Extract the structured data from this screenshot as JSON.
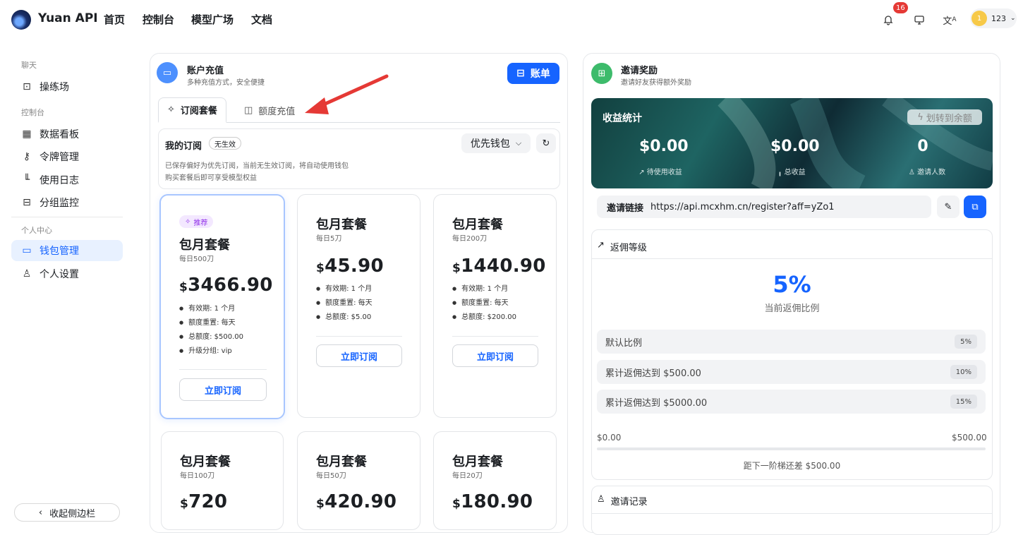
{
  "header": {
    "brand": "Yuan API",
    "nav": [
      "首页",
      "控制台",
      "模型广场",
      "文档"
    ],
    "notification_count": "16",
    "user_avatar": "1",
    "user_name": "123"
  },
  "sidebar": {
    "sections": [
      "聊天",
      "控制台",
      "个人中心"
    ],
    "items": [
      {
        "label": "操练场",
        "icon": "playground-icon"
      },
      {
        "label": "数据看板",
        "icon": "dashboard-icon"
      },
      {
        "label": "令牌管理",
        "icon": "key-icon"
      },
      {
        "label": "使用日志",
        "icon": "chart-icon"
      },
      {
        "label": "分组监控",
        "icon": "monitor-icon"
      },
      {
        "label": "钱包管理",
        "icon": "wallet-icon",
        "active": true
      },
      {
        "label": "个人设置",
        "icon": "user-icon"
      }
    ],
    "collapse_label": "收起侧边栏"
  },
  "recharge": {
    "title": "账户充值",
    "subtitle": "多种充值方式，安全便捷",
    "bill_button": "账单",
    "tabs": [
      "订阅套餐",
      "额度充值"
    ],
    "my_sub_title": "我的订阅",
    "my_sub_status": "无生效",
    "wallet_pref": "优先钱包",
    "note1": "已保存偏好为优先订阅，当前无生效订阅，将自动使用钱包",
    "note2": "购买套餐后即可享受模型权益",
    "recommend": "推荐",
    "subscribe": "立即订阅",
    "plans": [
      {
        "name": "包月套餐",
        "desc": "每日500刀",
        "price": "3466.90",
        "features": [
          "有效期: 1 个月",
          "额度重置: 每天",
          "总额度: $500.00",
          "升级分组: vip"
        ]
      },
      {
        "name": "包月套餐",
        "desc": "每日5刀",
        "price": "45.90",
        "features": [
          "有效期: 1 个月",
          "额度重置: 每天",
          "总额度: $5.00"
        ]
      },
      {
        "name": "包月套餐",
        "desc": "每日200刀",
        "price": "1440.90",
        "features": [
          "有效期: 1 个月",
          "额度重置: 每天",
          "总额度: $200.00"
        ]
      },
      {
        "name": "包月套餐",
        "desc": "每日100刀",
        "price": "720"
      },
      {
        "name": "包月套餐",
        "desc": "每日50刀",
        "price": "420.90"
      },
      {
        "name": "包月套餐",
        "desc": "每日20刀",
        "price": "180.90"
      }
    ],
    "currency": "$"
  },
  "invite": {
    "title": "邀请奖励",
    "subtitle": "邀请好友获得额外奖励",
    "stats_title": "收益统计",
    "transfer_button": "划转到余额",
    "stats": [
      {
        "value": "$0.00",
        "label": "待使用收益"
      },
      {
        "value": "$0.00",
        "label": "总收益"
      },
      {
        "value": "0",
        "label": "邀请人数"
      }
    ],
    "link_label": "邀请链接",
    "link": "https://api.mcxhm.cn/register?aff=yZo1",
    "level_title": "返佣等级",
    "rate": "5%",
    "rate_label": "当前返佣比例",
    "levels": [
      {
        "label": "默认比例",
        "tag": "5%"
      },
      {
        "label": "累计返佣达到 $500.00",
        "tag": "10%"
      },
      {
        "label": "累计返佣达到 $5000.00",
        "tag": "15%"
      }
    ],
    "progress_start": "$0.00",
    "progress_end": "$500.00",
    "progress_fraction": 0,
    "progress_text": "距下一阶梯还差 $500.00",
    "records_title": "邀请记录"
  },
  "colors": {
    "accent": "#1664ff",
    "annotation_arrow": "#e53935"
  }
}
